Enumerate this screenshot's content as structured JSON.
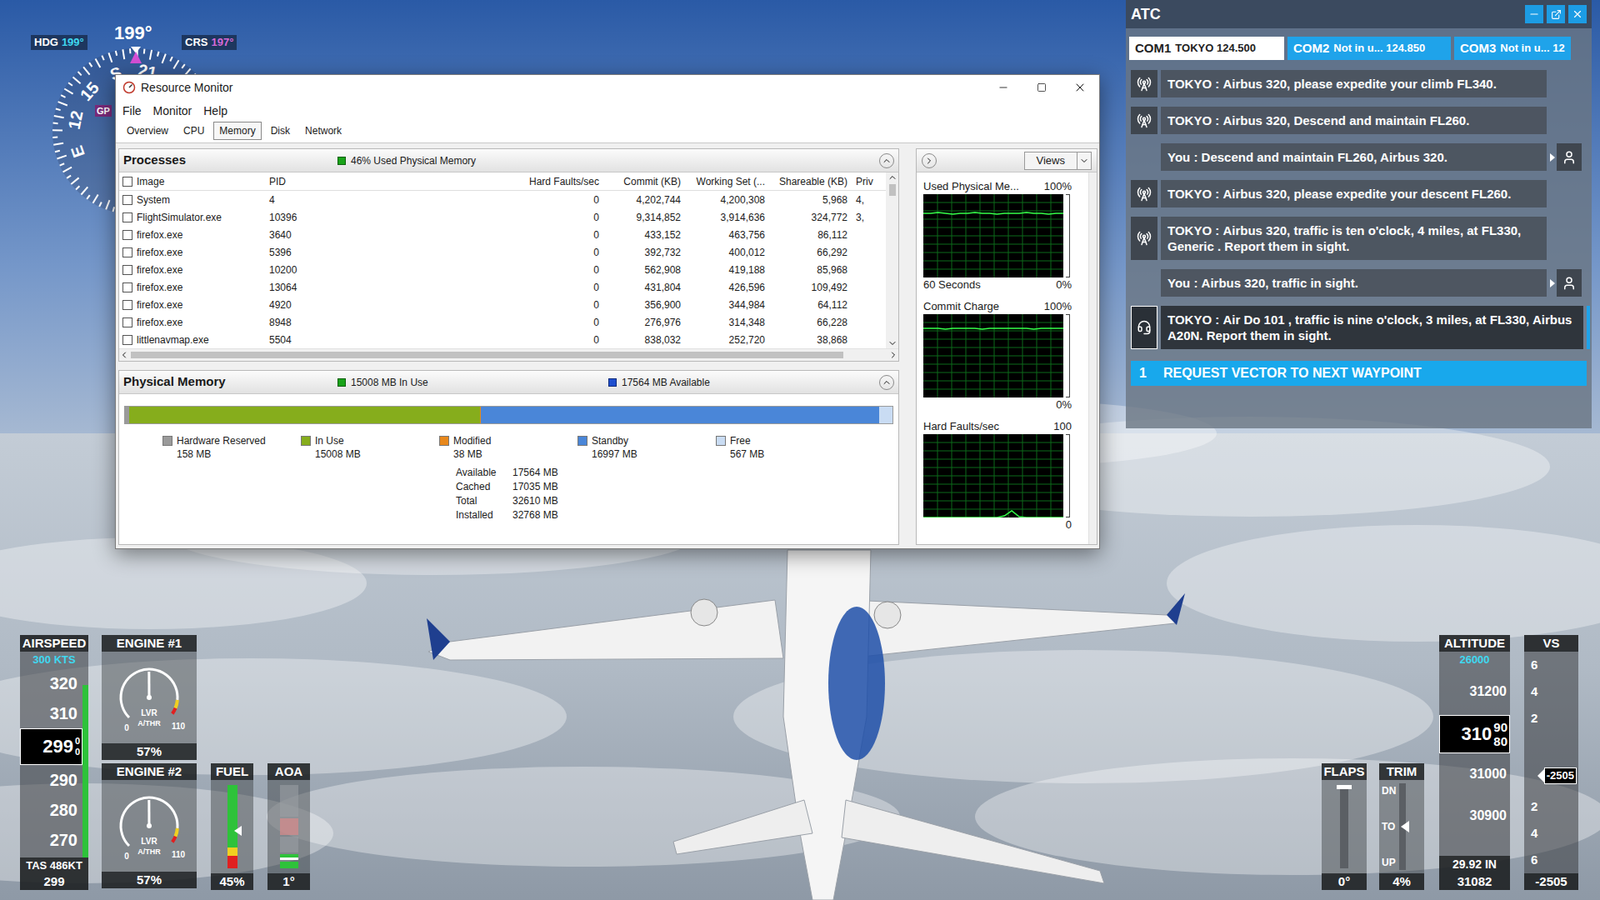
{
  "compass": {
    "hdg_label": "HDG",
    "hdg_value": "199°",
    "heading": "199°",
    "crs_label": "CRS",
    "crs_value": "197°",
    "rose": [
      "S",
      "21",
      "E",
      "12",
      "15"
    ],
    "gps": "GP"
  },
  "resource_monitor": {
    "title": "Resource Monitor",
    "menu": [
      "File",
      "Monitor",
      "Help"
    ],
    "tabs": [
      {
        "label": "Overview",
        "selected": false
      },
      {
        "label": "CPU",
        "selected": false
      },
      {
        "label": "Memory",
        "selected": true
      },
      {
        "label": "Disk",
        "selected": false
      },
      {
        "label": "Network",
        "selected": false
      }
    ],
    "processes": {
      "title": "Processes",
      "summary": "46% Used Physical Memory",
      "header_checked": false,
      "columns": [
        "Image",
        "PID",
        "Hard Faults/sec",
        "Commit (KB)",
        "Working Set (...",
        "Shareable (KB)",
        "Priv"
      ],
      "rows": [
        {
          "image": "System",
          "pid": "4",
          "hard_faults": "0",
          "commit": "4,202,744",
          "working_set": "4,200,308",
          "shareable": "5,968",
          "priv": "4,",
          "checked": false
        },
        {
          "image": "FlightSimulator.exe",
          "pid": "10396",
          "hard_faults": "0",
          "commit": "9,314,852",
          "working_set": "3,914,636",
          "shareable": "324,772",
          "priv": "3,",
          "checked": false
        },
        {
          "image": "firefox.exe",
          "pid": "3640",
          "hard_faults": "0",
          "commit": "433,152",
          "working_set": "463,756",
          "shareable": "86,112",
          "priv": "",
          "checked": false
        },
        {
          "image": "firefox.exe",
          "pid": "5396",
          "hard_faults": "0",
          "commit": "392,732",
          "working_set": "400,012",
          "shareable": "66,292",
          "priv": "",
          "checked": false
        },
        {
          "image": "firefox.exe",
          "pid": "10200",
          "hard_faults": "0",
          "commit": "562,908",
          "working_set": "419,188",
          "shareable": "85,968",
          "priv": "",
          "checked": false
        },
        {
          "image": "firefox.exe",
          "pid": "13064",
          "hard_faults": "0",
          "commit": "431,804",
          "working_set": "426,596",
          "shareable": "109,492",
          "priv": "",
          "checked": false
        },
        {
          "image": "firefox.exe",
          "pid": "4920",
          "hard_faults": "0",
          "commit": "356,900",
          "working_set": "344,984",
          "shareable": "64,112",
          "priv": "",
          "checked": false
        },
        {
          "image": "firefox.exe",
          "pid": "8948",
          "hard_faults": "0",
          "commit": "276,976",
          "working_set": "314,348",
          "shareable": "66,228",
          "priv": "",
          "checked": false
        },
        {
          "image": "littlenavmap.exe",
          "pid": "5504",
          "hard_faults": "0",
          "commit": "838,032",
          "working_set": "252,720",
          "shareable": "38,868",
          "priv": "",
          "checked": false
        }
      ]
    },
    "physical_memory": {
      "title": "Physical Memory",
      "in_use": "15008 MB In Use",
      "available": "17564 MB Available",
      "segments": [
        {
          "label": "Hardware Reserved",
          "value": "158 MB",
          "level": 0.005,
          "color": "#9a9a9a"
        },
        {
          "label": "In Use",
          "value": "15008 MB",
          "level": 0.458,
          "color": "#86ad1c"
        },
        {
          "label": "Modified",
          "value": "38 MB",
          "level": 0.001,
          "color": "#e8881c"
        },
        {
          "label": "Standby",
          "value": "16997 MB",
          "level": 0.519,
          "color": "#4a86d8"
        },
        {
          "label": "Free",
          "value": "567 MB",
          "level": 0.017,
          "color": "#c9dcf3"
        }
      ],
      "stats": [
        {
          "label": "Available",
          "value": "17564 MB"
        },
        {
          "label": "Cached",
          "value": "17035 MB"
        },
        {
          "label": "Total",
          "value": "32610 MB"
        },
        {
          "label": "Installed",
          "value": "32768 MB"
        }
      ]
    },
    "graphs": {
      "views": "Views",
      "items": [
        {
          "title": "Used Physical Me...",
          "max": "100%",
          "footer": "60 Seconds",
          "min": "0%",
          "values": [
            77,
            77,
            78,
            77,
            76,
            77,
            77,
            78,
            77,
            77,
            76,
            77,
            77,
            77,
            78,
            77,
            77,
            76,
            77,
            77
          ]
        },
        {
          "title": "Commit Charge",
          "max": "100%",
          "footer": "",
          "min": "0%",
          "values": [
            83,
            83,
            83,
            82,
            83,
            83,
            83,
            83,
            82,
            83,
            83,
            83,
            83,
            83,
            83,
            82,
            83,
            83,
            83,
            83
          ]
        },
        {
          "title": "Hard Faults/sec",
          "max": "100",
          "footer": "",
          "min": "0",
          "values": [
            0,
            0,
            0,
            0,
            0,
            0,
            0,
            0,
            0,
            0,
            0,
            2,
            8,
            1,
            0,
            0,
            0,
            0,
            0,
            0
          ]
        }
      ]
    }
  },
  "atc": {
    "title": "ATC",
    "tabs": [
      {
        "label": "COM1",
        "detail": "TOKYO 124.500",
        "selected": true
      },
      {
        "label": "COM2",
        "detail": "Not in u... 124.850",
        "selected": false
      },
      {
        "label": "COM3",
        "detail": "Not in u... 12",
        "selected": false
      }
    ],
    "messages": [
      {
        "kind": "atc",
        "speaker": "TOKYO :",
        "text": "Airbus 320, please expedite your climb FL340.",
        "highlighted": false
      },
      {
        "kind": "atc",
        "speaker": "TOKYO :",
        "text": "Airbus 320, Descend and maintain FL260.",
        "highlighted": false
      },
      {
        "kind": "pilot",
        "speaker": "You :",
        "text": "Descend and maintain FL260, Airbus 320.",
        "highlighted": false
      },
      {
        "kind": "atc",
        "speaker": "TOKYO :",
        "text": "Airbus 320, please expedite your descent FL260.",
        "highlighted": false
      },
      {
        "kind": "atc",
        "speaker": "TOKYO :",
        "text": "Airbus 320, traffic is ten o'clock, 4 miles, at FL330, Generic . Report them in sight.",
        "highlighted": false
      },
      {
        "kind": "pilot",
        "speaker": "You :",
        "text": "Airbus 320, traffic in sight.",
        "highlighted": false
      },
      {
        "kind": "atc",
        "speaker": "TOKYO :",
        "text": "Air Do 101 , traffic is nine o'clock, 3 miles, at FL330, Airbus A20N. Report them in sight.",
        "highlighted": true
      }
    ],
    "options": [
      {
        "number": "1",
        "text": "REQUEST VECTOR TO NEXT WAYPOINT",
        "selected": true
      }
    ]
  },
  "hud": {
    "airspeed": {
      "label": "AIRSPEED",
      "target": "300 KTS",
      "ticks_above": [
        "320",
        "310"
      ],
      "current": "299",
      "roll": [
        "0",
        "0"
      ],
      "ticks_below": [
        "290",
        "280",
        "270"
      ],
      "tas": "TAS 486KT",
      "readout": "299"
    },
    "engines": [
      {
        "label": "ENGINE #1",
        "min": "0",
        "max": "110",
        "mode": "LVR",
        "athr": "A/THR",
        "readout": "57%",
        "level": 0.518
      },
      {
        "label": "ENGINE #2",
        "min": "0",
        "max": "110",
        "mode": "LVR",
        "athr": "A/THR",
        "readout": "57%",
        "level": 0.518
      }
    ],
    "fuel": {
      "label": "FUEL",
      "readout": "45%",
      "level": 0.45
    },
    "aoa": {
      "label": "AOA",
      "readout": "1°",
      "level": 0.1
    },
    "flaps": {
      "label": "FLAPS",
      "readout": "0°",
      "level": 0
    },
    "trim": {
      "label": "TRIM",
      "top": "DN",
      "middle": "TO",
      "bottom": "UP",
      "readout": "4%",
      "level": 0.5
    },
    "altitude": {
      "label": "ALTITUDE",
      "target": "26000",
      "ticks_above": [
        "31200"
      ],
      "current": "310",
      "roll": [
        "90",
        "80"
      ],
      "ticks_below": [
        "31000",
        "30900"
      ],
      "baro": "29.92 IN",
      "readout": "31082"
    },
    "vs": {
      "label": "VS",
      "ticks_above": [
        "6",
        "4",
        "2"
      ],
      "ticks_below": [
        "2",
        "4",
        "6"
      ],
      "pointer": "-2505",
      "level": 0.56,
      "readout": "-2505"
    }
  }
}
